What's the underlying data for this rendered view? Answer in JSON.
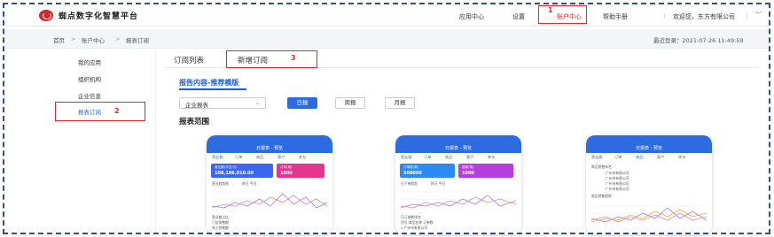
{
  "header": {
    "logo_text": "蜘点数字化智慧平台",
    "nav": [
      {
        "label": "应用中心"
      },
      {
        "label": "设置"
      },
      {
        "label": "账户中心"
      },
      {
        "label": "帮助手册"
      }
    ],
    "welcome": "欢迎您，东方有限公司",
    "separator": "|",
    "dropdown_glyph": "﹀",
    "callout_number": "1"
  },
  "breadcrumb": {
    "items": [
      "首页",
      "账户中心",
      "报表订阅"
    ],
    "separator": ">",
    "last_login": "最近登录：2021-07-26 11:49:59"
  },
  "sidebar": {
    "items": [
      {
        "label": "我的应用"
      },
      {
        "label": "组织机构"
      },
      {
        "label": "企业信息"
      },
      {
        "label": "报表订阅"
      }
    ],
    "callout_number": "2"
  },
  "content": {
    "tabs": [
      {
        "label": "订阅列表"
      },
      {
        "label": "新增订阅"
      }
    ],
    "tab_callout_number": "3",
    "section_title": "报告内容-推荐模版",
    "select_value": "企业报表",
    "select_chevron": "⌄",
    "period_buttons": [
      "日报",
      "周报",
      "月报"
    ],
    "scope_title": "报表范围"
  },
  "phones": [
    {
      "title": "日报表 - 预览",
      "tabs": [
        "营业额",
        "订单",
        "商品",
        "客户",
        "库存"
      ],
      "cards": [
        {
          "label": "营业额(今日/元)",
          "value": "108,186,810.00",
          "color": "#3a66f0"
        },
        {
          "label": "订单(笔)",
          "value": "1000",
          "color": "#e5358f"
        }
      ],
      "chart_label": "营业趋势图",
      "legend": "昨日  今日",
      "footer_label": "营业额占比",
      "footer_rows": [
        "门店销售额",
        "线上销售额"
      ]
    },
    {
      "title": "日报表 - 预览",
      "tabs": [
        "营业额",
        "订单",
        "商品",
        "客户",
        "库存"
      ],
      "cards": [
        {
          "label": "订单数(笔)",
          "value": "500000",
          "color": "#2a8cf0"
        },
        {
          "label": "退款(笔)",
          "value": "1000",
          "color": "#b63de0"
        }
      ],
      "chart_label": "日下单趋势",
      "legend": "昨日  今日",
      "footer_label": "日订单数排名",
      "footer_rows": [
        "序号  商品名称  订单数",
        "1  广州市有限公司"
      ]
    },
    {
      "title": "日报表 - 预览",
      "tabs": [
        "营业额",
        "订单",
        "商品",
        "客户",
        "库存"
      ],
      "cards": [],
      "chart_label": "商品销售排名",
      "legend": "",
      "footer_label": "商品销售趋势",
      "footer_rows": [
        "广州市有限公司",
        "广州市有限公司",
        "广州市有限公司",
        "广州市有限公司"
      ]
    }
  ]
}
